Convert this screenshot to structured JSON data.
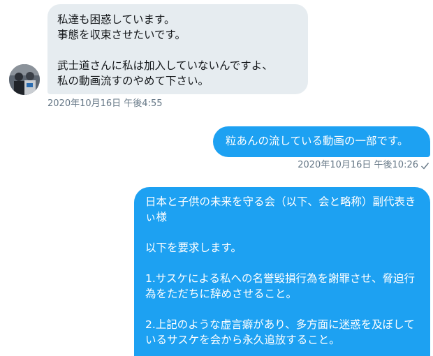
{
  "messages": [
    {
      "direction": "received",
      "text": "私達も困惑しています。\n事態を収束させたいです。\n\n武士道さんに私は加入していないんですよ、\n私の動画流すのやめて下さい。",
      "timestamp": "2020年10月16日 午後4:55"
    },
    {
      "direction": "sent",
      "text": "粒あんの流している動画の一部です。",
      "timestamp": "2020年10月16日 午後10:26",
      "status_icon": "checkmark-icon"
    },
    {
      "direction": "sent",
      "text": "日本と子供の未来を守る会（以下、会と略称）副代表きぃ様\n\n以下を要求します。\n\n1.サスケによる私への名誉毀損行為を謝罪させ、脅迫行為をただちに辞めさせること。\n\n2.上記のような虚言癖があり、多方面に迷惑を及ぼしているサスケを会から永久追放すること。"
    }
  ],
  "colors": {
    "received_bubble": "#e6ecf0",
    "sent_bubble": "#1da1f2",
    "timestamp": "#657786"
  }
}
